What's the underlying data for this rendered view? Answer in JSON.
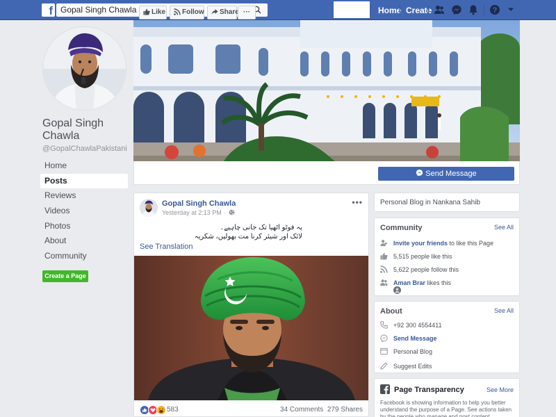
{
  "topbar": {
    "logo": "f",
    "search_value": "Gopal Singh Chawla",
    "home_label": "Home",
    "create_label": "Create"
  },
  "profile": {
    "name": "Gopal Singh Chawla",
    "handle": "@GopalChawlaPakistani"
  },
  "left_nav": {
    "items": [
      {
        "label": "Home"
      },
      {
        "label": "Posts"
      },
      {
        "label": "Reviews"
      },
      {
        "label": "Videos"
      },
      {
        "label": "Photos"
      },
      {
        "label": "About"
      },
      {
        "label": "Community"
      }
    ],
    "create_page": "Create a Page"
  },
  "actions": {
    "like": "Like",
    "follow": "Follow",
    "share": "Share",
    "more": "···",
    "send_message": "Send Message"
  },
  "post": {
    "author": "Gopal Singh Chawla",
    "time": "Yesterday at 2:13 PM ·",
    "more": "•••",
    "text_line1": "یہ فوٹو اٹھیا تک جانی چاہیے۔",
    "text_line2": "لائک اور شیئر کرنا مت بھولیں، شکریہ",
    "see_translation": "See Translation",
    "reaction_count": "583",
    "comments": "34 Comments",
    "shares": "279 Shares"
  },
  "right": {
    "blog_line": "Personal Blog in Nankana Sahib",
    "community": {
      "title": "Community",
      "see_all": "See All",
      "invite_link": "Invite your friends",
      "invite_rest": " to like this Page",
      "likes": "5,515 people like this",
      "follows": "5,622 people follow this",
      "friend_name": "Aman Brar",
      "friend_rest": " likes this"
    },
    "about": {
      "title": "About",
      "see_all": "See All",
      "phone": "+92 300 4554411",
      "send_message": "Send Message",
      "category": "Personal Blog",
      "suggest": "Suggest Edits"
    },
    "transparency": {
      "title": "Page Transparency",
      "see_more": "See More",
      "text": "Facebook is showing information to help you better understand the purpose of a Page. See actions taken by the people who manage and post content."
    }
  },
  "colors": {
    "brand": "#4267b2",
    "create_green": "#42b72a",
    "turban_green": "#2fa543"
  }
}
